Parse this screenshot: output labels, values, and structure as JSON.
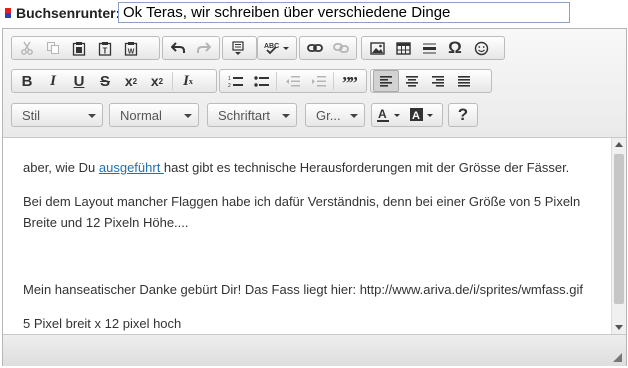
{
  "title": {
    "label": "Buchsenrunter:",
    "value": "Ok Teras, wir schreiben über verschiedene Dinge"
  },
  "toolbar": {
    "combos": {
      "style": "Stil",
      "format": "Normal",
      "font": "Schriftart",
      "size": "Gr..."
    },
    "help": "?",
    "omega": "Ω"
  },
  "content": {
    "p1_before": "aber, wie Du ",
    "p1_link": "ausgeführt ",
    "p1_after": "hast gibt es technische Herausforderungen mit der Grösse der Fässer.",
    "p2_line1": "Bei dem Layout mancher Flaggen habe ich dafür Verständnis, denn bei einer Größe von 5 Pixeln",
    "p2_line2": "Breite und 12 Pixeln Höhe....",
    "p3": "Mein hanseatischer Danke gebürt Dir! Das Fass liegt hier: http://www.ariva.de/i/sprites/wmfass.gif",
    "p4": "5 Pixel breit x 12 pixel hoch"
  },
  "colors": {
    "link": "#1f6fb4",
    "input_border": "#8aa2c8"
  }
}
